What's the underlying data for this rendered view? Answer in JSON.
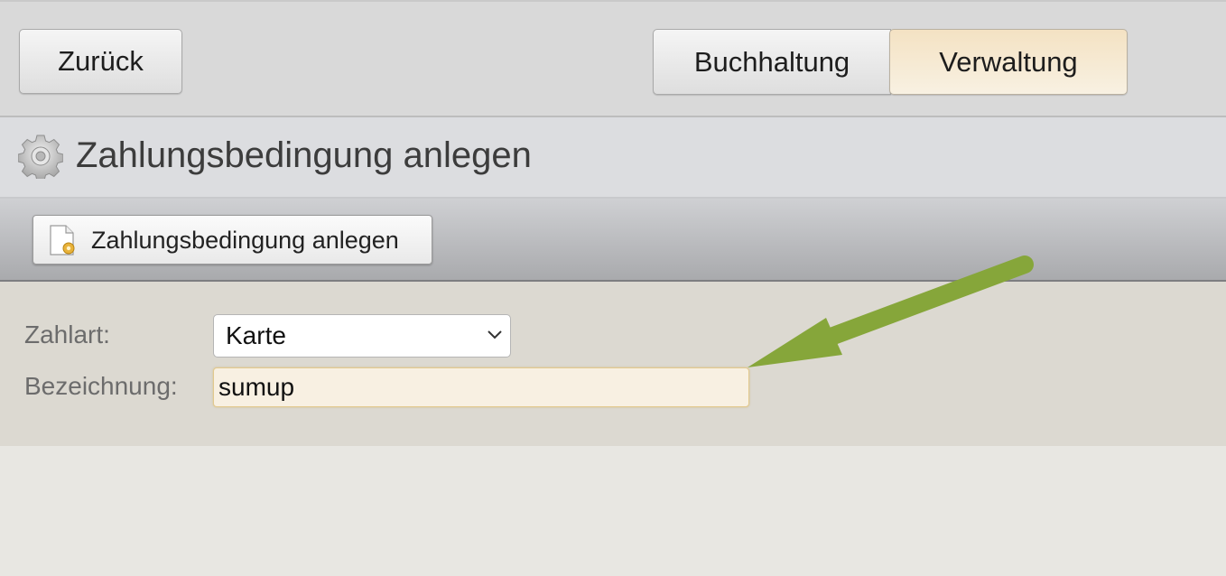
{
  "nav": {
    "back_label": "Zurück",
    "tabs": [
      {
        "label": "Buchhaltung",
        "active": false
      },
      {
        "label": "Verwaltung",
        "active": true
      }
    ]
  },
  "page": {
    "title": "Zahlungsbedingung anlegen",
    "title_icon": "gear-icon"
  },
  "toolbar": {
    "create_button_label": "Zahlungsbedingung anlegen",
    "create_button_icon": "new-document-icon"
  },
  "form": {
    "payment_type": {
      "label": "Zahlart:",
      "selected": "Karte"
    },
    "designation": {
      "label": "Bezeichnung:",
      "value": "sumup"
    }
  },
  "annotation": {
    "type": "arrow",
    "color": "#86a63a"
  },
  "colors": {
    "active_tab": "#f6e9d2",
    "input_focus_bg": "#f8f0e2",
    "arrow": "#86a63a"
  }
}
